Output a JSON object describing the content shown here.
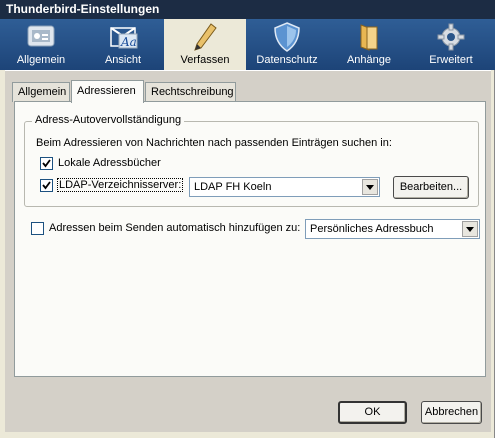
{
  "window": {
    "title": "Thunderbird-Einstellungen"
  },
  "toolbar": {
    "items": [
      {
        "label": "Allgemein",
        "icon": "general-icon"
      },
      {
        "label": "Ansicht",
        "icon": "display-icon"
      },
      {
        "label": "Verfassen",
        "icon": "pen-icon",
        "active": true
      },
      {
        "label": "Datenschutz",
        "icon": "shield-icon"
      },
      {
        "label": "Anhänge",
        "icon": "folder-icon"
      },
      {
        "label": "Erweitert",
        "icon": "gear-icon"
      }
    ]
  },
  "tabs": [
    "Allgemein",
    "Adressieren",
    "Rechtschreibung"
  ],
  "selected_tab": "Adressieren",
  "autocomplete": {
    "group_title": "Adress-Autovervollständigung",
    "description": "Beim Adressieren von Nachrichten nach passenden Einträgen suchen in:",
    "local_label": "Lokale Adressbücher",
    "local_checked": true,
    "ldap_label": "LDAP-Verzeichnisserver:",
    "ldap_checked": true,
    "ldap_server": "LDAP FH Koeln",
    "edit_button": "Bearbeiten..."
  },
  "auto_add": {
    "label": "Adressen beim Senden automatisch hinzufügen zu:",
    "checked": false,
    "target": "Persönliches Adressbuch"
  },
  "footer": {
    "ok": "OK",
    "cancel": "Abbrechen"
  },
  "colors": {
    "toolbar": "#2a5589",
    "titlebar": "#1c2c44",
    "dialog_bg": "#d4d0c8"
  }
}
